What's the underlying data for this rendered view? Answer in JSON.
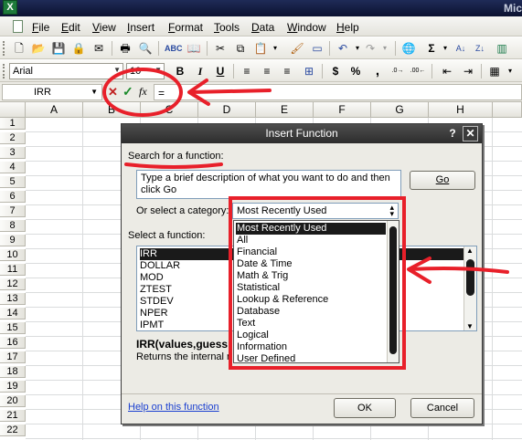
{
  "window": {
    "app_title_fragment": "Mic"
  },
  "menu": [
    "File",
    "Edit",
    "View",
    "Insert",
    "Format",
    "Tools",
    "Data",
    "Window",
    "Help"
  ],
  "formatting": {
    "font_name": "Arial",
    "font_size": "10",
    "bold": "B",
    "italic": "I",
    "underline": "U",
    "currency": "$",
    "percent": "%"
  },
  "formula_bar": {
    "name_box": "IRR",
    "cancel_symbol": "✕",
    "enter_symbol": "✓",
    "fx_label": "fx",
    "formula": "="
  },
  "sheet": {
    "columns": [
      "A",
      "B",
      "C",
      "D",
      "E",
      "F",
      "G",
      "H"
    ],
    "rows": [
      "1",
      "2",
      "3",
      "4",
      "5",
      "6",
      "7",
      "8",
      "9",
      "10",
      "11",
      "12",
      "13",
      "14",
      "15",
      "16",
      "17",
      "18",
      "19",
      "20",
      "21",
      "22"
    ]
  },
  "dialog": {
    "title": "Insert Function",
    "help_symbol": "?",
    "close_symbol": "✕",
    "search_label": "Search for a function:",
    "search_text": "Type a brief description of what you want to do and then click Go",
    "go_button": "Go",
    "category_label": "Or select a category:",
    "category_selected": "Most Recently Used",
    "category_options": [
      "Most Recently Used",
      "All",
      "Financial",
      "Date & Time",
      "Math & Trig",
      "Statistical",
      "Lookup & Reference",
      "Database",
      "Text",
      "Logical",
      "Information",
      "User Defined"
    ],
    "function_label": "Select a function:",
    "functions": [
      "IRR",
      "DOLLAR",
      "MOD",
      "ZTEST",
      "STDEV",
      "NPER",
      "IPMT"
    ],
    "syntax": "IRR(values,guess",
    "description": "Returns the internal r",
    "help_link": "Help on this function",
    "ok_button": "OK",
    "cancel_button": "Cancel"
  },
  "colors": {
    "annotation": "#e8202a",
    "dialog_title": "#3a3a3a",
    "link": "#1a3fd0"
  }
}
